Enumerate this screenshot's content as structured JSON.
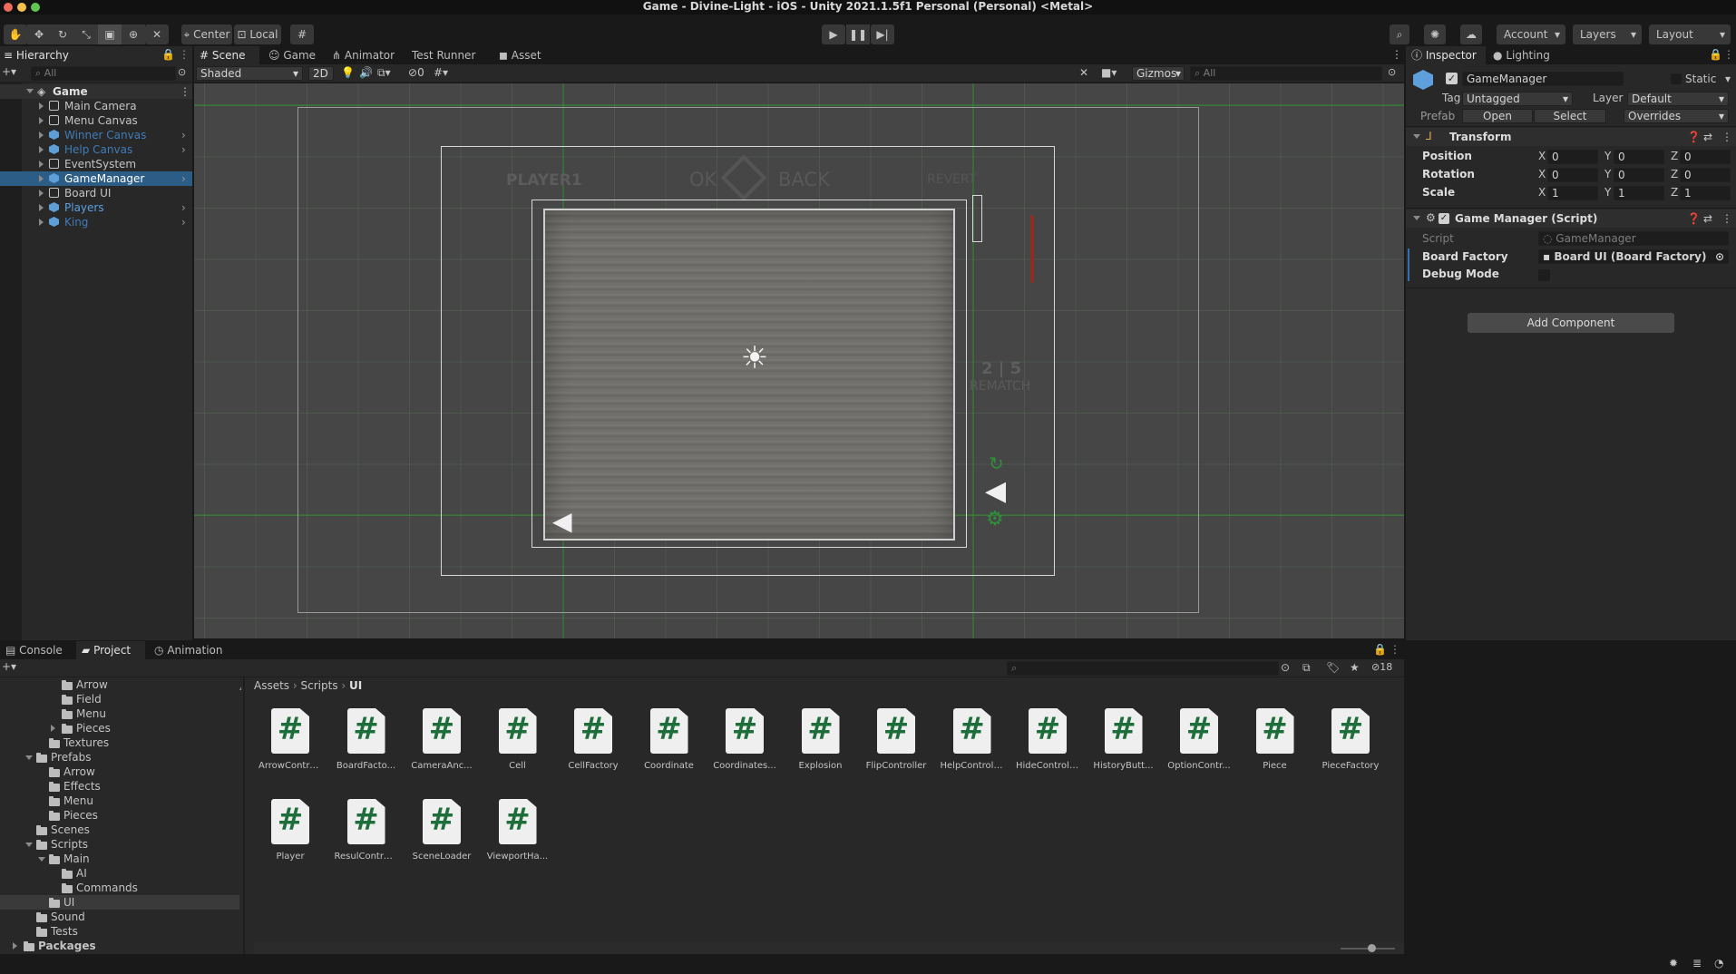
{
  "window": {
    "title": "Game - Divine-Light - iOS - Unity 2021.1.5f1 Personal (Personal) <Metal>"
  },
  "toolbar": {
    "tools": [
      "hand-tool-icon",
      "move-tool-icon",
      "rotate-tool-icon",
      "scale-tool-icon",
      "rect-tool-icon",
      "transform-tool-icon",
      "custom-tool-icon"
    ],
    "pivot_label": "Center",
    "space_label": "Local",
    "account_label": "Account",
    "layers_label": "Layers",
    "layout_label": "Layout"
  },
  "hierarchy": {
    "tab_label": "Hierarchy",
    "search_placeholder": "All",
    "scene_name": "Game",
    "items": [
      {
        "label": "Main Camera",
        "prefab": false,
        "color": "#c4c4c4"
      },
      {
        "label": "Menu Canvas",
        "prefab": false,
        "color": "#c4c4c4"
      },
      {
        "label": "Winner Canvas",
        "prefab": true,
        "color": "#3f7cb8"
      },
      {
        "label": "Help Canvas",
        "prefab": true,
        "color": "#3f7cb8"
      },
      {
        "label": "EventSystem",
        "prefab": false,
        "color": "#c4c4c4"
      },
      {
        "label": "GameManager",
        "prefab": true,
        "color": "#ffffff"
      },
      {
        "label": "Board UI",
        "prefab": false,
        "color": "#c4c4c4"
      },
      {
        "label": "Players",
        "prefab": true,
        "color": "#5b9fe0"
      },
      {
        "label": "King",
        "prefab": true,
        "color": "#3f7cb8"
      }
    ]
  },
  "scene_tabs": [
    "Scene",
    "Game",
    "Animator",
    "Test Runner",
    "Asset Store"
  ],
  "scene_toolbar": {
    "shading": "Shaded",
    "mode_2d": "2D",
    "hidden_count": "0",
    "gizmos": "Gizmos",
    "search_placeholder": "All"
  },
  "game_view": {
    "player_label": "PLAYER1",
    "ok_label": "OK",
    "back_label": "BACK",
    "revert_label": "REVERT",
    "score": "2 | 5",
    "rematch_label": "REMATCH"
  },
  "inspector": {
    "tabs": [
      "Inspector",
      "Lighting"
    ],
    "object_name": "GameManager",
    "static_label": "Static",
    "tag_label": "Tag",
    "tag_value": "Untagged",
    "layer_label": "Layer",
    "layer_value": "Default",
    "prefab_label": "Prefab",
    "prefab_open": "Open",
    "prefab_select": "Select",
    "prefab_overrides": "Overrides",
    "transform_title": "Transform",
    "position_label": "Position",
    "rotation_label": "Rotation",
    "scale_label": "Scale",
    "position": [
      "0",
      "0",
      "0"
    ],
    "rotation": [
      "0",
      "0",
      "0"
    ],
    "scale": [
      "1",
      "1",
      "1"
    ],
    "axis": [
      "X",
      "Y",
      "Z"
    ],
    "script_component_title": "Game Manager (Script)",
    "script_label": "Script",
    "script_value": "GameManager",
    "board_factory_label": "Board Factory",
    "board_factory_value": "Board UI (Board Factory)",
    "debug_mode_label": "Debug Mode",
    "add_component": "Add Component"
  },
  "bottom_tabs": [
    "Console",
    "Project",
    "Animation"
  ],
  "project": {
    "visible_count": "18",
    "breadcrumb": [
      "Assets",
      "Scripts",
      "UI"
    ],
    "tree": [
      {
        "label": "Arrow",
        "depth": 3,
        "expanded": null
      },
      {
        "label": "Field",
        "depth": 3,
        "expanded": null
      },
      {
        "label": "Menu",
        "depth": 3,
        "expanded": null
      },
      {
        "label": "Pieces",
        "depth": 3,
        "expanded": false
      },
      {
        "label": "Textures",
        "depth": 2,
        "expanded": null
      },
      {
        "label": "Prefabs",
        "depth": 1,
        "expanded": true
      },
      {
        "label": "Arrow",
        "depth": 2,
        "expanded": null
      },
      {
        "label": "Effects",
        "depth": 2,
        "expanded": null
      },
      {
        "label": "Menu",
        "depth": 2,
        "expanded": null
      },
      {
        "label": "Pieces",
        "depth": 2,
        "expanded": null
      },
      {
        "label": "Scenes",
        "depth": 1,
        "expanded": null
      },
      {
        "label": "Scripts",
        "depth": 1,
        "expanded": true
      },
      {
        "label": "Main",
        "depth": 2,
        "expanded": true
      },
      {
        "label": "AI",
        "depth": 3,
        "expanded": null
      },
      {
        "label": "Commands",
        "depth": 3,
        "expanded": null
      },
      {
        "label": "UI",
        "depth": 2,
        "expanded": null
      },
      {
        "label": "Sound",
        "depth": 1,
        "expanded": null
      },
      {
        "label": "Tests",
        "depth": 1,
        "expanded": null
      },
      {
        "label": "Packages",
        "depth": 0,
        "expanded": false
      }
    ],
    "scripts": [
      "ArrowContro...",
      "BoardFacto...",
      "CameraAnc...",
      "Cell",
      "CellFactory",
      "Coordinate",
      "Coordinates...",
      "Explosion",
      "FlipController",
      "HelpControll...",
      "HideControll...",
      "HistoryButt...",
      "OptionContr...",
      "Piece",
      "PieceFactory",
      "Player",
      "ResulControl...",
      "SceneLoader",
      "ViewportHa..."
    ]
  }
}
